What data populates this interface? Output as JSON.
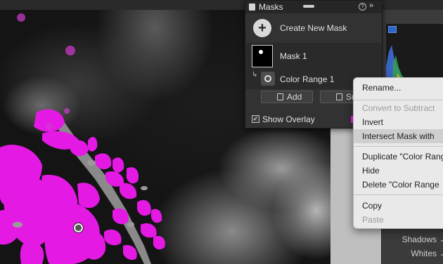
{
  "colors": {
    "overlay": "#e41ae4",
    "panel_bg": "#323232",
    "menu_bg": "#e9e9e9"
  },
  "masks_panel": {
    "title": "Masks",
    "help_icon": "?",
    "collapse_icon": "»",
    "create_label": "Create New Mask",
    "mask": {
      "name": "Mask 1"
    },
    "component": {
      "arrow": "↳",
      "name": "Color Range 1"
    },
    "add_label": "Add",
    "subtract_label": "Subtr",
    "show_overlay_label": "Show Overlay",
    "show_overlay_checked": true
  },
  "context_menu": {
    "rename": "Rename...",
    "convert": "Convert to Subtract",
    "invert": "Invert",
    "intersect": "Intersect Mask with",
    "duplicate": "Duplicate \"Color Rang",
    "hide": "Hide",
    "delete": "Delete \"Color Range",
    "copy": "Copy",
    "paste": "Paste"
  },
  "develop_panel": {
    "shadows_label": "Shadows",
    "whites_label": "Whites"
  }
}
